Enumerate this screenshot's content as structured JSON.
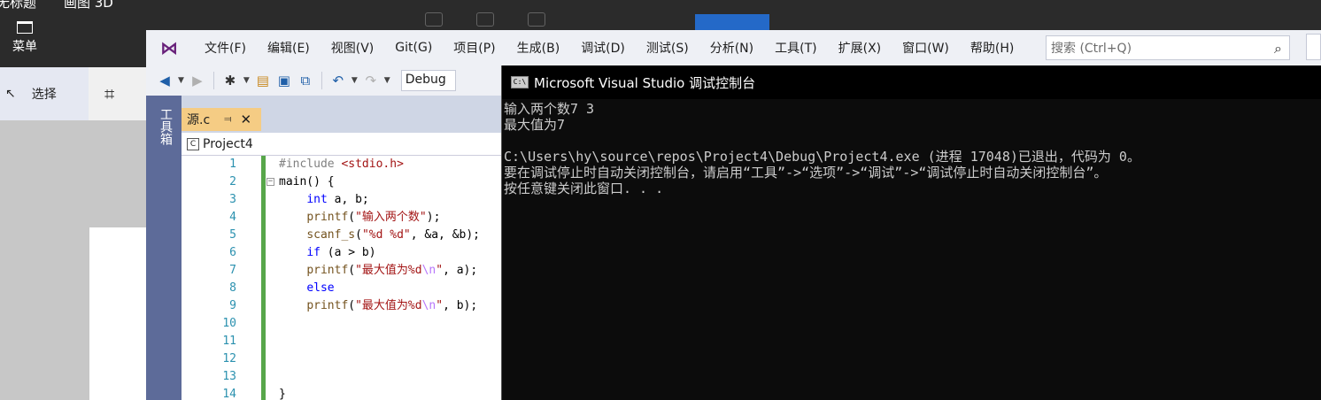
{
  "paint": {
    "tabs": [
      "无标题",
      "画图 3D"
    ],
    "menu_label": "菜单",
    "select_label": "选择"
  },
  "vs": {
    "menu": [
      "文件(F)",
      "编辑(E)",
      "视图(V)",
      "Git(G)",
      "项目(P)",
      "生成(B)",
      "调试(D)",
      "测试(S)",
      "分析(N)",
      "工具(T)",
      "扩展(X)",
      "窗口(W)",
      "帮助(H)"
    ],
    "search_placeholder": "搜索 (Ctrl+Q)",
    "config": "Debug",
    "toolbox_label": "工具箱",
    "doc_tab": "源.c",
    "project": "Project4"
  },
  "code": {
    "line_numbers": [
      "1",
      "2",
      "3",
      "4",
      "5",
      "6",
      "7",
      "8",
      "9",
      "10",
      "11",
      "12",
      "13",
      "14"
    ],
    "lines": [
      "#include <stdio.h>",
      "main() {",
      "    int a, b;",
      "    printf(\"输入两个数\");",
      "    scanf_s(\"%d %d\", &a, &b);",
      "    if (a > b)",
      "    printf(\"最大值为%d\\n\", a);",
      "    else",
      "    printf(\"最大值为%d\\n\", b);",
      "",
      "",
      "",
      "",
      "}"
    ]
  },
  "console": {
    "title": "Microsoft Visual Studio 调试控制台",
    "lines": [
      "输入两个数7 3",
      "最大值为7",
      "",
      "C:\\Users\\hy\\source\\repos\\Project4\\Debug\\Project4.exe (进程 17048)已退出，代码为 0。",
      "要在调试停止时自动关闭控制台，请启用“工具”->“选项”->“调试”->“调试停止时自动关闭控制台”。",
      "按任意键关闭此窗口. . ."
    ]
  }
}
